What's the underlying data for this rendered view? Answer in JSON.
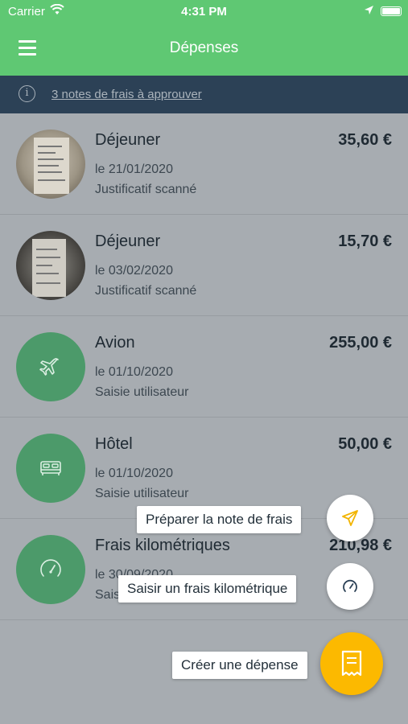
{
  "status_bar": {
    "carrier": "Carrier",
    "time": "4:31 PM"
  },
  "header": {
    "title": "Dépenses",
    "menu_icon": "hamburger-icon"
  },
  "banner": {
    "text": "3 notes de frais à approuver",
    "icon": "info-icon"
  },
  "expenses": [
    {
      "name": "Déjeuner",
      "amount": "35,60 €",
      "date": "le 21/01/2020",
      "source": "Justificatif scanné",
      "thumbnail": "receipt-photo"
    },
    {
      "name": "Déjeuner",
      "amount": "15,70 €",
      "date": "le 03/02/2020",
      "source": "Justificatif scanné",
      "thumbnail": "receipt-photo"
    },
    {
      "name": "Avion",
      "amount": "255,00 €",
      "date": "le 01/10/2020",
      "source": "Saisie utilisateur",
      "thumbnail": "airplane-icon"
    },
    {
      "name": "Hôtel",
      "amount": "50,00 €",
      "date": "le 01/10/2020",
      "source": "Saisie utilisateur",
      "thumbnail": "bed-icon"
    },
    {
      "name": "Frais kilométriques",
      "amount": "210,98 €",
      "date": "le 30/09/2020",
      "source": "Saisie utilisateur",
      "thumbnail": "speedometer-icon"
    }
  ],
  "fab_menu": {
    "prepare_label": "Préparer la note de frais",
    "mileage_label": "Saisir un frais kilométrique",
    "create_label": "Créer une dépense"
  },
  "colors": {
    "header": "#5fc873",
    "banner": "#2c4156",
    "fab": "#fcb900",
    "thumb_green": "#4c9a6a"
  }
}
